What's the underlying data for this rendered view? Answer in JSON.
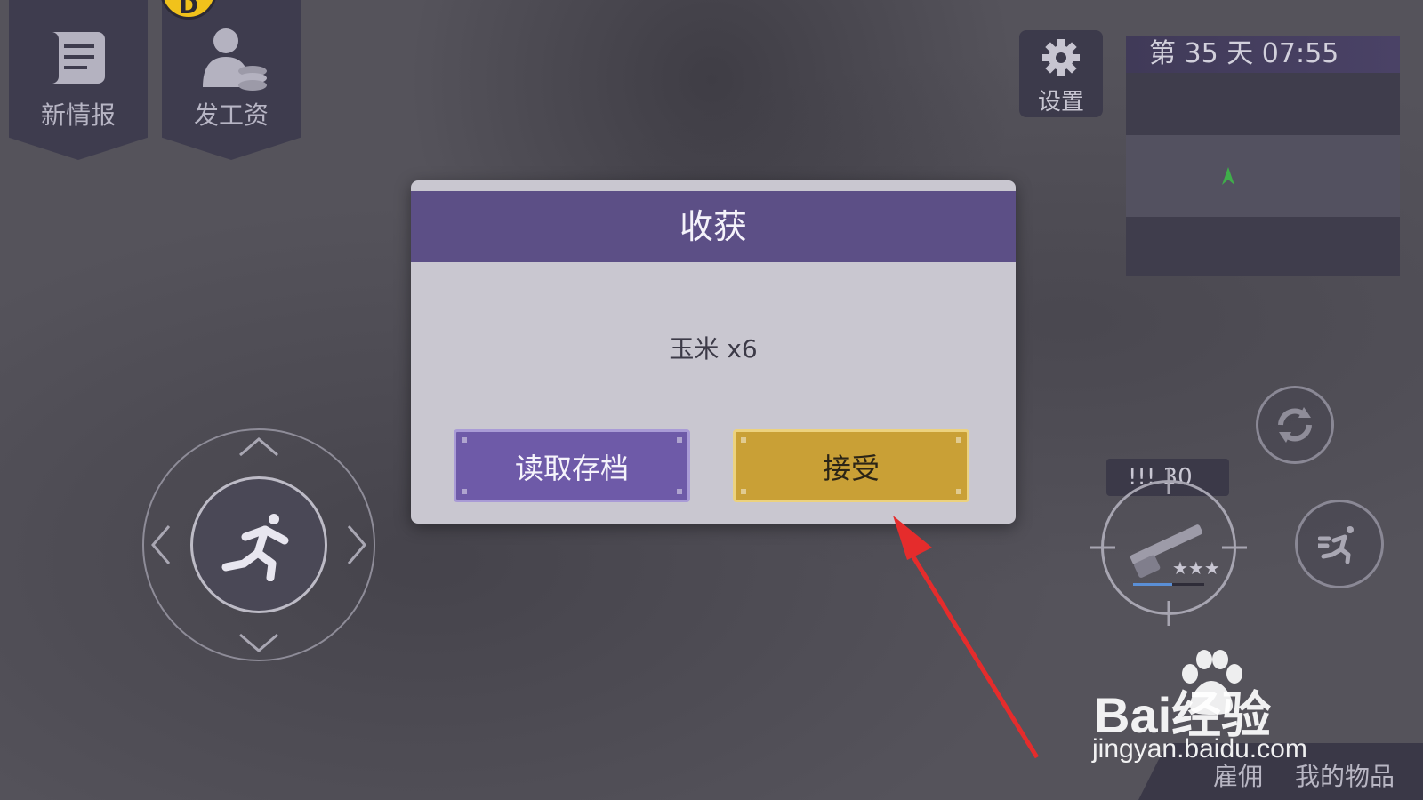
{
  "hud": {
    "news_label": "新情报",
    "pay_label": "发工资",
    "settings_label": "设置",
    "day_time": "第 35 天  07:55",
    "ammo": "!!!  30",
    "hire_label": "雇佣",
    "inventory_label": "我的物品"
  },
  "dialog": {
    "title": "收获",
    "reward": "玉米 x6",
    "load_button": "读取存档",
    "accept_button": "接受"
  },
  "watermark": {
    "brand": "Bai经验",
    "url": "jingyan.baidu.com"
  },
  "weapon": {
    "stars": 3
  },
  "colors": {
    "dialog_header": "#5c4f86",
    "accept": "#c9a036",
    "load": "#6e5aa8",
    "annotation_arrow": "#e52c2c"
  }
}
